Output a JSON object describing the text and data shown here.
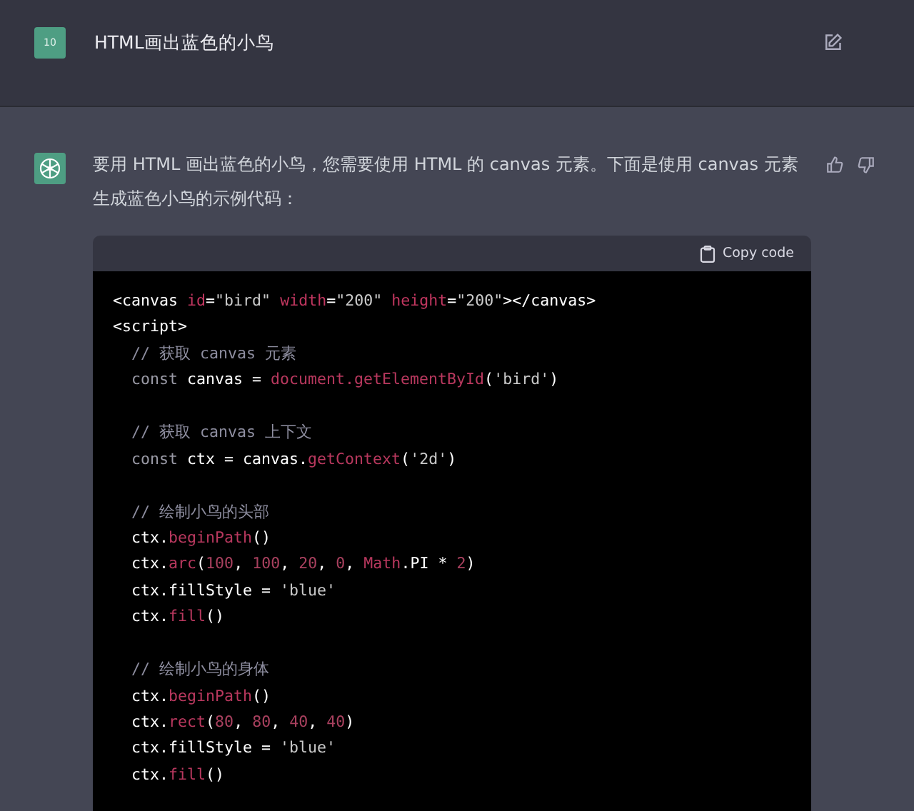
{
  "user_message": {
    "avatar": "10",
    "text": "HTML画出蓝色的小鸟"
  },
  "assistant_message": {
    "text": "要用 HTML 画出蓝色的小鸟，您需要使用 HTML 的 canvas 元素。下面是使用 canvas 元素生成蓝色小鸟的示例代码：",
    "code_block": {
      "copy_label": "Copy code",
      "lines": [
        {
          "kind": "code",
          "tokens": [
            {
              "t": "<canvas ",
              "kind": "plain"
            },
            {
              "t": "id",
              "kind": "attr"
            },
            {
              "t": "=",
              "kind": "plain"
            },
            {
              "t": "\"bird\" ",
              "kind": "str"
            },
            {
              "t": "width",
              "kind": "attr"
            },
            {
              "t": "=",
              "kind": "plain"
            },
            {
              "t": "\"200\" ",
              "kind": "str"
            },
            {
              "t": "height",
              "kind": "attr"
            },
            {
              "t": "=",
              "kind": "plain"
            },
            {
              "t": "\"200\"",
              "kind": "str"
            },
            {
              "t": "></canvas>",
              "kind": "plain"
            }
          ]
        },
        {
          "kind": "code",
          "tokens": [
            {
              "t": "<script>",
              "kind": "plain"
            }
          ]
        },
        {
          "kind": "code",
          "tokens": [
            {
              "t": "  // 获取 canvas 元素",
              "kind": "cmt"
            }
          ]
        },
        {
          "kind": "code",
          "tokens": [
            {
              "t": "  const ",
              "kind": "kw"
            },
            {
              "t": "canvas = ",
              "kind": "plain"
            },
            {
              "t": "document.getElementById",
              "kind": "fn"
            },
            {
              "t": "(",
              "kind": "plain"
            },
            {
              "t": "'bird'",
              "kind": "str"
            },
            {
              "t": ")",
              "kind": "plain"
            }
          ]
        },
        {
          "kind": "blank"
        },
        {
          "kind": "code",
          "tokens": [
            {
              "t": "  // 获取 canvas 上下文",
              "kind": "cmt"
            }
          ]
        },
        {
          "kind": "code",
          "tokens": [
            {
              "t": "  const ",
              "kind": "kw"
            },
            {
              "t": "ctx = canvas.",
              "kind": "plain"
            },
            {
              "t": "getContext",
              "kind": "fn"
            },
            {
              "t": "(",
              "kind": "plain"
            },
            {
              "t": "'2d'",
              "kind": "str"
            },
            {
              "t": ")",
              "kind": "plain"
            }
          ]
        },
        {
          "kind": "blank"
        },
        {
          "kind": "code",
          "tokens": [
            {
              "t": "  // 绘制小鸟的头部",
              "kind": "cmt"
            }
          ]
        },
        {
          "kind": "code",
          "tokens": [
            {
              "t": "  ctx.",
              "kind": "plain"
            },
            {
              "t": "beginPath",
              "kind": "fn"
            },
            {
              "t": "()",
              "kind": "plain"
            }
          ]
        },
        {
          "kind": "code",
          "tokens": [
            {
              "t": "  ctx.",
              "kind": "plain"
            },
            {
              "t": "arc",
              "kind": "fn"
            },
            {
              "t": "(",
              "kind": "plain"
            },
            {
              "t": "100",
              "kind": "num"
            },
            {
              "t": ", ",
              "kind": "plain"
            },
            {
              "t": "100",
              "kind": "num"
            },
            {
              "t": ", ",
              "kind": "plain"
            },
            {
              "t": "20",
              "kind": "num"
            },
            {
              "t": ", ",
              "kind": "plain"
            },
            {
              "t": "0",
              "kind": "num"
            },
            {
              "t": ", ",
              "kind": "plain"
            },
            {
              "t": "Math",
              "kind": "fn"
            },
            {
              "t": ".PI * ",
              "kind": "plain"
            },
            {
              "t": "2",
              "kind": "num"
            },
            {
              "t": ")",
              "kind": "plain"
            }
          ]
        },
        {
          "kind": "code",
          "tokens": [
            {
              "t": "  ctx.fillStyle = ",
              "kind": "plain"
            },
            {
              "t": "'blue'",
              "kind": "str"
            }
          ]
        },
        {
          "kind": "code",
          "tokens": [
            {
              "t": "  ctx.",
              "kind": "plain"
            },
            {
              "t": "fill",
              "kind": "fn"
            },
            {
              "t": "()",
              "kind": "plain"
            }
          ]
        },
        {
          "kind": "blank"
        },
        {
          "kind": "code",
          "tokens": [
            {
              "t": "  // 绘制小鸟的身体",
              "kind": "cmt"
            }
          ]
        },
        {
          "kind": "code",
          "tokens": [
            {
              "t": "  ctx.",
              "kind": "plain"
            },
            {
              "t": "beginPath",
              "kind": "fn"
            },
            {
              "t": "()",
              "kind": "plain"
            }
          ]
        },
        {
          "kind": "code",
          "tokens": [
            {
              "t": "  ctx.",
              "kind": "plain"
            },
            {
              "t": "rect",
              "kind": "fn"
            },
            {
              "t": "(",
              "kind": "plain"
            },
            {
              "t": "80",
              "kind": "num"
            },
            {
              "t": ", ",
              "kind": "plain"
            },
            {
              "t": "80",
              "kind": "num"
            },
            {
              "t": ", ",
              "kind": "plain"
            },
            {
              "t": "40",
              "kind": "num"
            },
            {
              "t": ", ",
              "kind": "plain"
            },
            {
              "t": "40",
              "kind": "num"
            },
            {
              "t": ")",
              "kind": "plain"
            }
          ]
        },
        {
          "kind": "code",
          "tokens": [
            {
              "t": "  ctx.fillStyle = ",
              "kind": "plain"
            },
            {
              "t": "'blue'",
              "kind": "str"
            }
          ]
        },
        {
          "kind": "code",
          "tokens": [
            {
              "t": "  ctx.",
              "kind": "plain"
            },
            {
              "t": "fill",
              "kind": "fn"
            },
            {
              "t": "()",
              "kind": "plain"
            }
          ]
        }
      ]
    }
  }
}
